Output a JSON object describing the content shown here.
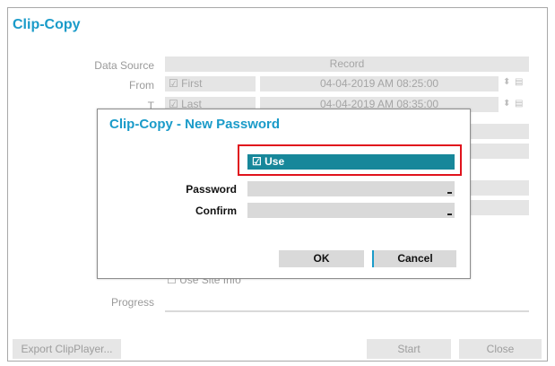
{
  "window": {
    "title": "Clip-Copy"
  },
  "form": {
    "data_source_label": "Data Source",
    "data_source_value": "Record",
    "from_label": "From",
    "from_checkbox": "First",
    "from_datetime": "04-04-2019  AM 08:25:00",
    "to_label": "T",
    "to_checkbox": "Last",
    "to_datetime": "04-04-2019  AM 08:35:00",
    "use_site_info": "Use Site Info",
    "progress_label": "Progress",
    "progress": 0
  },
  "footer": {
    "export_label": "Export ClipPlayer...",
    "start_label": "Start",
    "close_label": "Close"
  },
  "modal": {
    "title": "Clip-Copy - New Password",
    "use_label": "Use",
    "use_checked": true,
    "password_label": "Password",
    "password_value": "",
    "confirm_label": "Confirm",
    "confirm_value": "",
    "ok_label": "OK",
    "cancel_label": "Cancel"
  },
  "colors": {
    "title": "#1a9bc9",
    "use_bar": "#17879a",
    "highlight": "#e0131c"
  }
}
